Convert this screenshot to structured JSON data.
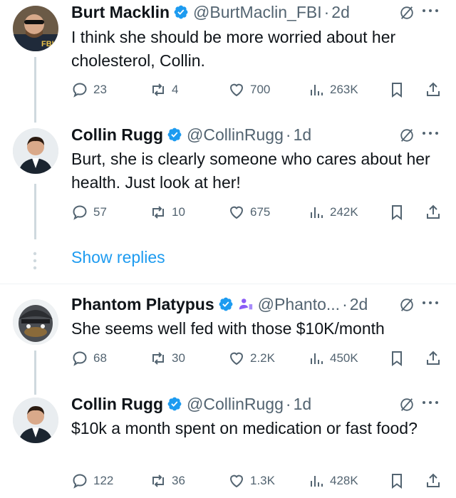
{
  "tweets": [
    {
      "name": "Burt Macklin",
      "handle": "@BurtMaclin_FBI",
      "time": "2d",
      "text": "I think she should be more worried about her cholesterol, Collin.",
      "avatar_badge": "FBI",
      "stats": {
        "replies": "23",
        "reposts": "4",
        "likes": "700",
        "views": "263K"
      }
    },
    {
      "name": "Collin Rugg",
      "handle": "@CollinRugg",
      "time": "1d",
      "text": "Burt, she is clearly someone who cares about her health. Just look at her!",
      "stats": {
        "replies": "57",
        "reposts": "10",
        "likes": "675",
        "views": "242K"
      }
    },
    {
      "name": "Phantom Platypus",
      "handle": "@Phanto...",
      "time": "2d",
      "text": "She seems well fed with those $10K/month",
      "stats": {
        "replies": "68",
        "reposts": "30",
        "likes": "2.2K",
        "views": "450K"
      }
    },
    {
      "name": "Collin Rugg",
      "handle": "@CollinRugg",
      "time": "1d",
      "text": "$10k a month spent on medication or fast food?",
      "stats": {
        "replies": "122",
        "reposts": "36",
        "likes": "1.3K",
        "views": "428K"
      }
    }
  ],
  "show_replies_label": "Show replies",
  "separator": "·",
  "icons": {
    "verified": "verified-badge-icon",
    "grok": "grok-icon",
    "more": "more-icon",
    "reply": "reply-icon",
    "repost": "repost-icon",
    "like": "like-icon",
    "views": "views-icon",
    "bookmark": "bookmark-icon",
    "share": "share-icon",
    "affiliate": "affiliate-icon"
  },
  "colors": {
    "accent": "#1d9bf0",
    "text": "#0f1419",
    "secondary": "#536471",
    "line": "#cfd9de"
  }
}
